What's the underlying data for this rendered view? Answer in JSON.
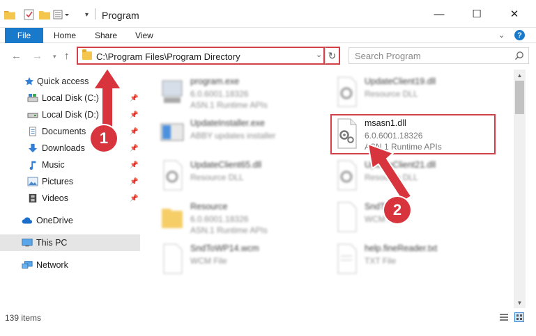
{
  "window": {
    "title": "Program",
    "minimize_glyph": "—",
    "maximize_glyph": "☐",
    "close_glyph": "✕"
  },
  "ribbon": {
    "file": "File",
    "home": "Home",
    "share": "Share",
    "view": "View",
    "help": "?"
  },
  "address": {
    "path": "C:\\Program Files\\Program Directory",
    "search_placeholder": "Search Program"
  },
  "sidebar": {
    "quick_access": "Quick access",
    "items": [
      {
        "label": "Local Disk (C:)",
        "icon": "drive-icon",
        "pinned": true
      },
      {
        "label": "Local Disk (D:)",
        "icon": "drive-icon",
        "pinned": true
      },
      {
        "label": "Documents",
        "icon": "documents-icon",
        "pinned": true
      },
      {
        "label": "Downloads",
        "icon": "download-arrow-icon",
        "pinned": true
      },
      {
        "label": "Music",
        "icon": "music-note-icon",
        "pinned": true
      },
      {
        "label": "Pictures",
        "icon": "pictures-icon",
        "pinned": true
      },
      {
        "label": "Videos",
        "icon": "film-icon",
        "pinned": true
      }
    ],
    "onedrive": "OneDrive",
    "this_pc": "This PC",
    "network": "Network"
  },
  "files": {
    "left": [
      {
        "name": "program.exe",
        "line2": "6.0.6001.18326",
        "line3": "ASN.1 Runtime APIs"
      },
      {
        "name": "UpdateInstaller.exe",
        "line2": "ABBY updates installer",
        "line3": ""
      },
      {
        "name": "UpdateClient65.dll",
        "line2": "Resource DLL",
        "line3": ""
      },
      {
        "name": "Resource",
        "line2": "6.0.6001.18326",
        "line3": "ASN.1 Runtime APIs"
      },
      {
        "name": "SndToWP14.wcm",
        "line2": "WCM File",
        "line3": ""
      }
    ],
    "right": [
      {
        "name": "UpdateClient19.dll",
        "line2": "Resource DLL",
        "line3": ""
      },
      {
        "name": "msasn1.dll",
        "line2": "6.0.6001.18326",
        "line3": "ASN.1 Runtime APIs"
      },
      {
        "name": "UpdateClient21.dll",
        "line2": "Resource DLL",
        "line3": ""
      },
      {
        "name": "SndTo    wcm",
        "line2": "WCM File",
        "line3": ""
      },
      {
        "name": "help.fineReader.txt",
        "line2": "TXT File",
        "line3": ""
      }
    ]
  },
  "status": {
    "count": "139 items"
  },
  "annotations": {
    "step1": "1",
    "step2": "2"
  },
  "colors": {
    "accent": "#1979ca",
    "highlight_red": "#d3404a",
    "badge_red": "#d8343d",
    "folder_yellow": "#f4c64e"
  }
}
